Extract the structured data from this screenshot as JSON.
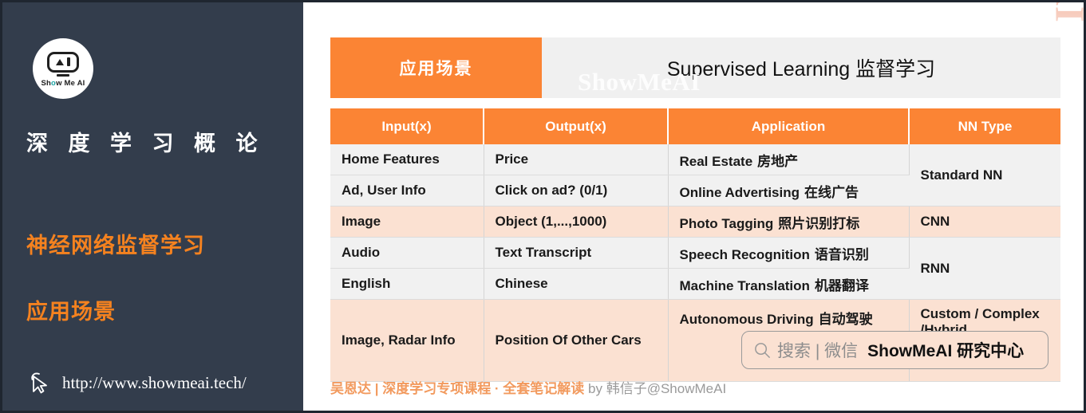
{
  "sidebar": {
    "logo": {
      "face_label": "AI",
      "brand": "Show Me AI",
      "brand_pre": "Sh",
      "brand_o": "o",
      "brand_post": "w Me AI"
    },
    "course_title": "深 度 学 习 概 论",
    "subtitle_line1": "神经网络监督学习",
    "subtitle_line2": "应用场景",
    "url": "http://www.showmeai.tech/",
    "bg_color": "#333d4c",
    "accent_color": "#f5821f"
  },
  "header": {
    "tag": "应用场景",
    "title": "Supervised Learning 监督学习",
    "watermark": "ShowMeAI",
    "tag_color": "#fb8434",
    "strip_color": "#f0f0f0"
  },
  "vertical_watermark": "ShowMeAI",
  "table": {
    "columns": [
      "Input(x)",
      "Output(x)",
      "Application",
      "NN Type"
    ],
    "rows": [
      {
        "input": "Home Features",
        "output": "Price",
        "application_en": "Real Estate",
        "application_cn": "房地产",
        "nn_type": "Standard NN",
        "nn_rowspan": 2,
        "shade": "gray"
      },
      {
        "input": "Ad, User Info",
        "output": "Click on ad? (0/1)",
        "application_en": "Online Advertising",
        "application_cn": "在线广告",
        "nn_type": null,
        "shade": "gray"
      },
      {
        "input": "Image",
        "output": "Object (1,...,1000)",
        "application_en": "Photo Tagging",
        "application_cn": "照片识别打标",
        "nn_type": "CNN",
        "nn_rowspan": 1,
        "shade": "peach"
      },
      {
        "input": "Audio",
        "output": "Text Transcript",
        "application_en": "Speech Recognition",
        "application_cn": "语音识别",
        "nn_type": "RNN",
        "nn_rowspan": 2,
        "shade": "gray"
      },
      {
        "input": "English",
        "output": "Chinese",
        "application_en": "Machine Translation",
        "application_cn": "机器翻译",
        "nn_type": null,
        "shade": "gray"
      },
      {
        "input": "Image, Radar Info",
        "output": "Position Of Other Cars",
        "application_en": "Autonomous Driving",
        "application_cn": "自动驾驶",
        "nn_type": "Custom / Complex /Hybrid",
        "nn_rowspan": 1,
        "shade": "peach"
      }
    ],
    "header_bg": "#fb8434",
    "row_gray": "#f1f1f1",
    "row_peach": "#fbe1d2"
  },
  "search_overlay": {
    "icon": "search-icon",
    "placeholder_text": "搜索 | 微信",
    "brand_text": "ShowMeAI 研究中心"
  },
  "footer": {
    "lead": "吴恩达 | 深度学习专项课程 · 全套笔记解读",
    "by": " by 韩信子@ShowMeAI"
  }
}
